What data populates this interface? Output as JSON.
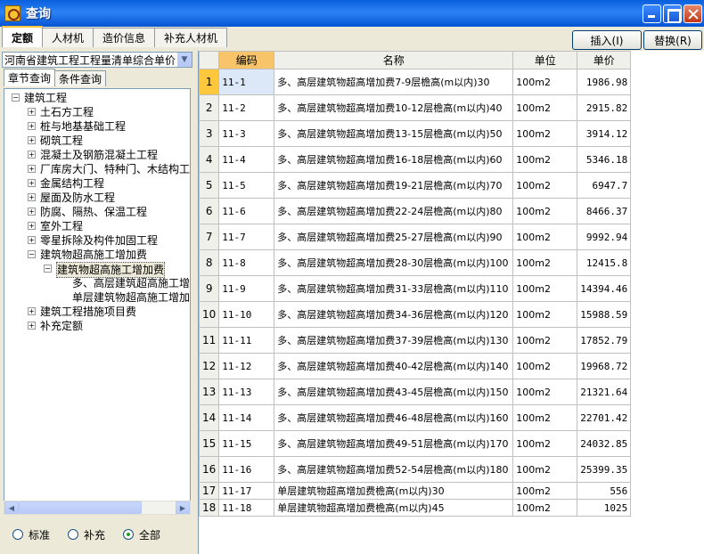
{
  "window": {
    "title": "查询"
  },
  "top_tabs": [
    "定额",
    "人材机",
    "造价信息",
    "补充人材机"
  ],
  "buttons": {
    "insert": "插入(I)",
    "replace": "替换(R)"
  },
  "left": {
    "quota_select": "河南省建筑工程工程量清单综合单价",
    "sub_tabs": [
      "章节查询",
      "条件查询"
    ],
    "tree": [
      {
        "label": "建筑工程",
        "level": 0,
        "exp": "-"
      },
      {
        "label": "土石方工程",
        "level": 1,
        "exp": "+"
      },
      {
        "label": "桩与地基基础工程",
        "level": 1,
        "exp": "+"
      },
      {
        "label": "砌筑工程",
        "level": 1,
        "exp": "+"
      },
      {
        "label": "混凝土及钢筋混凝土工程",
        "level": 1,
        "exp": "+"
      },
      {
        "label": "厂库房大门、特种门、木结构工程",
        "level": 1,
        "exp": "+"
      },
      {
        "label": "金属结构工程",
        "level": 1,
        "exp": "+"
      },
      {
        "label": "屋面及防水工程",
        "level": 1,
        "exp": "+"
      },
      {
        "label": "防腐、隔热、保温工程",
        "level": 1,
        "exp": "+"
      },
      {
        "label": "室外工程",
        "level": 1,
        "exp": "+"
      },
      {
        "label": "零星拆除及构件加固工程",
        "level": 1,
        "exp": "+"
      },
      {
        "label": "建筑物超高施工增加费",
        "level": 1,
        "exp": "-"
      },
      {
        "label": "建筑物超高施工增加费",
        "level": 2,
        "exp": "-",
        "selected": true
      },
      {
        "label": "多、高层建筑超高施工增加费",
        "level": 3,
        "exp": ""
      },
      {
        "label": "单层建筑物超高施工增加费",
        "level": 3,
        "exp": ""
      },
      {
        "label": "建筑工程措施项目费",
        "level": 1,
        "exp": "+"
      },
      {
        "label": "补充定额",
        "level": 1,
        "exp": "+"
      }
    ],
    "radios": [
      {
        "label": "标准",
        "checked": false
      },
      {
        "label": "补充",
        "checked": false
      },
      {
        "label": "全部",
        "checked": true
      }
    ]
  },
  "grid": {
    "columns": [
      "编码",
      "名称",
      "单位",
      "单价"
    ],
    "rows": [
      {
        "idx": "1",
        "code": "11-1",
        "name": "多、高层建筑物超高增加费7-9层檐高(m以内)30",
        "unit": "100m2",
        "price": "1986.98"
      },
      {
        "idx": "2",
        "code": "11-2",
        "name": "多、高层建筑物超高增加费10-12层檐高(m以内)40",
        "unit": "100m2",
        "price": "2915.82"
      },
      {
        "idx": "3",
        "code": "11-3",
        "name": "多、高层建筑物超高增加费13-15层檐高(m以内)50",
        "unit": "100m2",
        "price": "3914.12"
      },
      {
        "idx": "4",
        "code": "11-4",
        "name": "多、高层建筑物超高增加费16-18层檐高(m以内)60",
        "unit": "100m2",
        "price": "5346.18"
      },
      {
        "idx": "5",
        "code": "11-5",
        "name": "多、高层建筑物超高增加费19-21层檐高(m以内)70",
        "unit": "100m2",
        "price": "6947.7"
      },
      {
        "idx": "6",
        "code": "11-6",
        "name": "多、高层建筑物超高增加费22-24层檐高(m以内)80",
        "unit": "100m2",
        "price": "8466.37"
      },
      {
        "idx": "7",
        "code": "11-7",
        "name": "多、高层建筑物超高增加费25-27层檐高(m以内)90",
        "unit": "100m2",
        "price": "9992.94"
      },
      {
        "idx": "8",
        "code": "11-8",
        "name": "多、高层建筑物超高增加费28-30层檐高(m以内)100",
        "unit": "100m2",
        "price": "12415.8"
      },
      {
        "idx": "9",
        "code": "11-9",
        "name": "多、高层建筑物超高增加费31-33层檐高(m以内)110",
        "unit": "100m2",
        "price": "14394.46"
      },
      {
        "idx": "10",
        "code": "11-10",
        "name": "多、高层建筑物超高增加费34-36层檐高(m以内)120",
        "unit": "100m2",
        "price": "15988.59"
      },
      {
        "idx": "11",
        "code": "11-11",
        "name": "多、高层建筑物超高增加费37-39层檐高(m以内)130",
        "unit": "100m2",
        "price": "17852.79"
      },
      {
        "idx": "12",
        "code": "11-12",
        "name": "多、高层建筑物超高增加费40-42层檐高(m以内)140",
        "unit": "100m2",
        "price": "19968.72"
      },
      {
        "idx": "13",
        "code": "11-13",
        "name": "多、高层建筑物超高增加费43-45层檐高(m以内)150",
        "unit": "100m2",
        "price": "21321.64"
      },
      {
        "idx": "14",
        "code": "11-14",
        "name": "多、高层建筑物超高增加费46-48层檐高(m以内)160",
        "unit": "100m2",
        "price": "22701.42"
      },
      {
        "idx": "15",
        "code": "11-15",
        "name": "多、高层建筑物超高增加费49-51层檐高(m以内)170",
        "unit": "100m2",
        "price": "24032.85"
      },
      {
        "idx": "16",
        "code": "11-16",
        "name": "多、高层建筑物超高增加费52-54层檐高(m以内)180",
        "unit": "100m2",
        "price": "25399.35"
      },
      {
        "idx": "17",
        "code": "11-17",
        "name": "单层建筑物超高增加费檐高(m以内)30",
        "unit": "100m2",
        "price": "556"
      },
      {
        "idx": "18",
        "code": "11-18",
        "name": "单层建筑物超高增加费檐高(m以内)45",
        "unit": "100m2",
        "price": "1025"
      }
    ]
  }
}
